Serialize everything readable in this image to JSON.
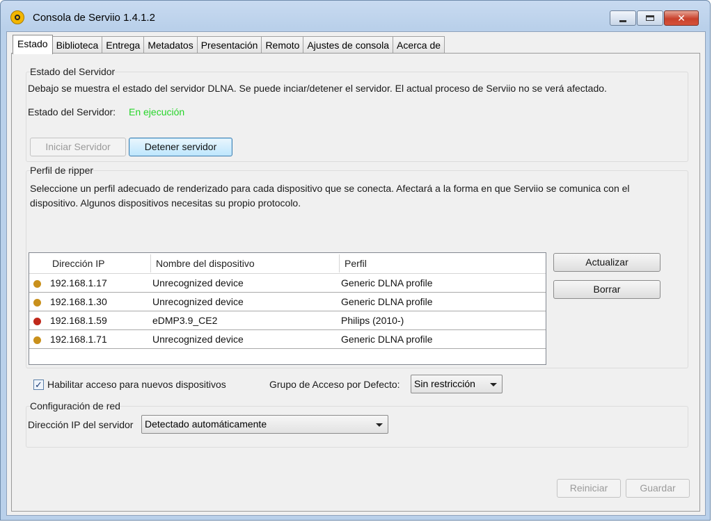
{
  "window": {
    "title": "Consola de Serviio 1.4.1.2",
    "close_glyph": "✕"
  },
  "tabs": [
    "Estado",
    "Biblioteca",
    "Entrega",
    "Metadatos",
    "Presentación",
    "Remoto",
    "Ajustes de consola",
    "Acerca de"
  ],
  "server_status": {
    "group_title": "Estado del Servidor",
    "description": "Debajo se muestra el estado del servidor DLNA. Se puede inciar/detener el servidor. El actual proceso de Serviio no se verá afectado.",
    "status_label": "Estado del Servidor:",
    "status_value": "En ejecución",
    "start_button": "Iniciar Servidor",
    "stop_button": "Detener servidor"
  },
  "ripper": {
    "group_title": "Perfil de ripper",
    "description_line1": "Seleccione un perfil adecuado de renderizado para cada dispositivo que se conecta. Afectará a la forma en que Serviio se comunica con el",
    "description_line2": "dispositivo. Algunos dispositivos necesitas su propio protocolo.",
    "columns": [
      "Dirección IP",
      "Nombre del dispositivo",
      "Perfil"
    ],
    "rows": [
      {
        "ip": "192.168.1.17",
        "name": "Unrecognized device",
        "profile": "Generic DLNA profile",
        "dot_color": "#c9901b"
      },
      {
        "ip": "192.168.1.30",
        "name": "Unrecognized device",
        "profile": "Generic DLNA profile",
        "dot_color": "#c9901b"
      },
      {
        "ip": "192.168.1.59",
        "name": "eDMP3.9_CE2",
        "profile": "Philips (2010-)",
        "dot_color": "#c0281b"
      },
      {
        "ip": "192.168.1.71",
        "name": "Unrecognized device",
        "profile": "Generic DLNA profile",
        "dot_color": "#c9901b"
      }
    ],
    "refresh_button": "Actualizar",
    "delete_button": "Borrar",
    "enable_access_label": "Habilitar acceso para nuevos dispositivos",
    "enable_access_checked": true,
    "check_glyph": "✓",
    "default_group_label": "Grupo de Acceso por Defecto:",
    "default_group_value": "Sin restricción"
  },
  "network": {
    "group_title": "Configuración de red",
    "ip_label": "Dirección IP del servidor",
    "ip_value": "Detectado automáticamente"
  },
  "footer": {
    "restart_button": "Reiniciar",
    "save_button": "Guardar"
  }
}
